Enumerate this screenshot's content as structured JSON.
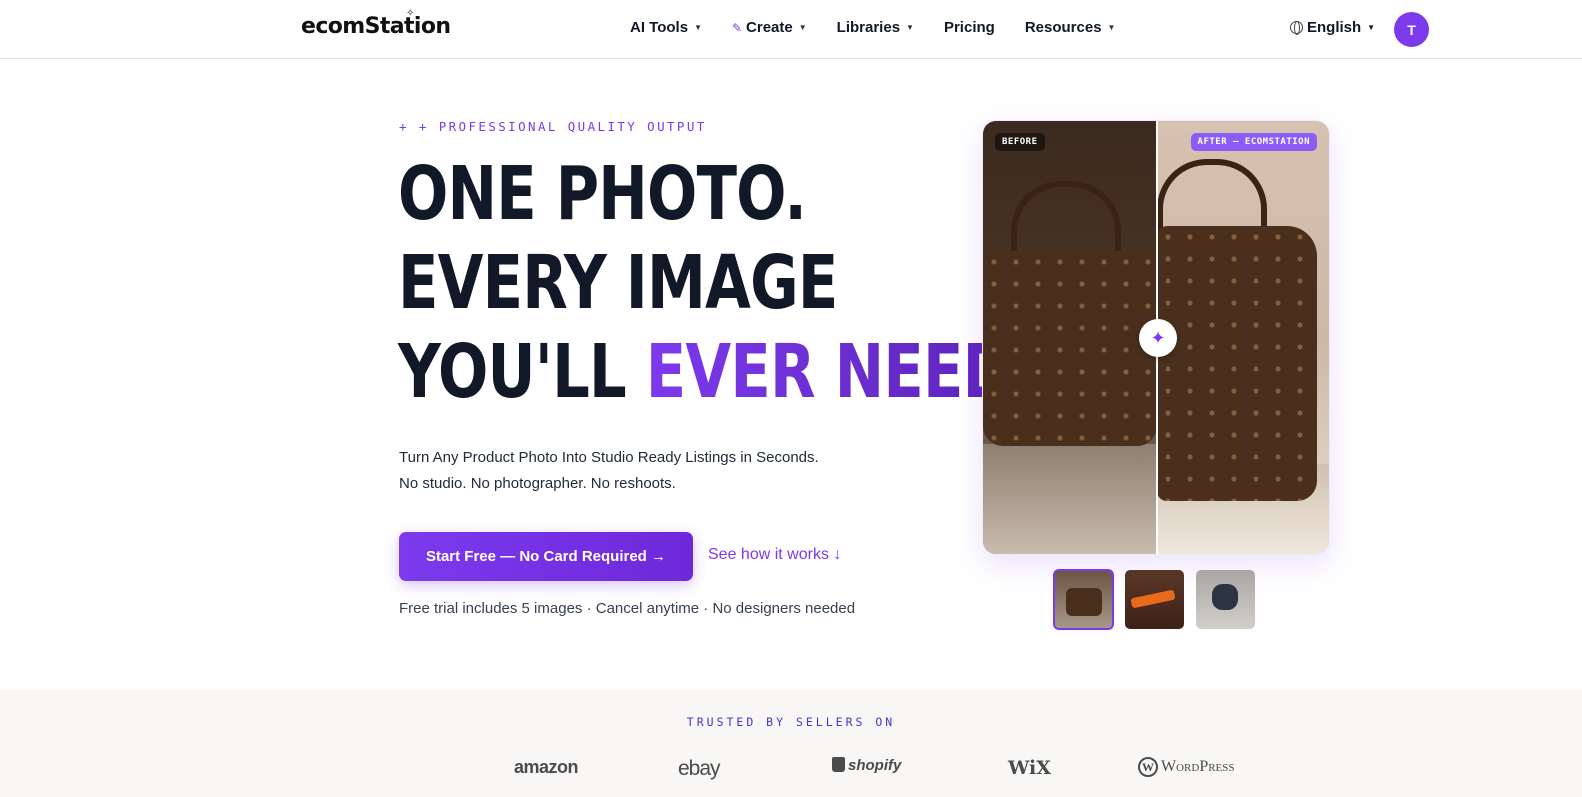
{
  "nav": {
    "logo": "ecomStation",
    "items": [
      {
        "label": "AI Tools",
        "has_caret": true
      },
      {
        "label": "Create",
        "has_caret": true
      },
      {
        "label": "Libraries",
        "has_caret": true
      },
      {
        "label": "Pricing",
        "has_caret": false
      },
      {
        "label": "Resources",
        "has_caret": true
      }
    ],
    "language": "English",
    "avatar_initial": "T"
  },
  "hero": {
    "eyebrow": "+ + PROFESSIONAL QUALITY OUTPUT",
    "headline_line1": "ONE PHOTO.",
    "headline_line2": "EVERY IMAGE",
    "headline_line3_start": "YOU'LL ",
    "headline_line3_accent": "EVER NEED.",
    "sub_line1": "Turn Any Product Photo Into Studio Ready Listings in Seconds.",
    "sub_line2": "No studio. No photographer. No reshoots.",
    "cta_label": "Start Free — No Card Required →",
    "secondary_link": "See how it works ↓",
    "fine_print": "Free trial includes 5 images · Cancel anytime · No designers needed"
  },
  "compare": {
    "before_tag": "BEFORE",
    "after_tag": "AFTER — ECOMSTATION",
    "slider_position": 0.5,
    "thumbnails": [
      {
        "name": "handbag",
        "active": true
      },
      {
        "name": "orange-tube",
        "active": false
      },
      {
        "name": "earbuds",
        "active": false
      }
    ]
  },
  "trusted": {
    "heading": "TRUSTED BY SELLERS ON",
    "brands": [
      "amazon",
      "ebay",
      "shopify",
      "WiX",
      "WordPress"
    ]
  },
  "colors": {
    "accent": "#7c3aed",
    "text": "#111827"
  }
}
